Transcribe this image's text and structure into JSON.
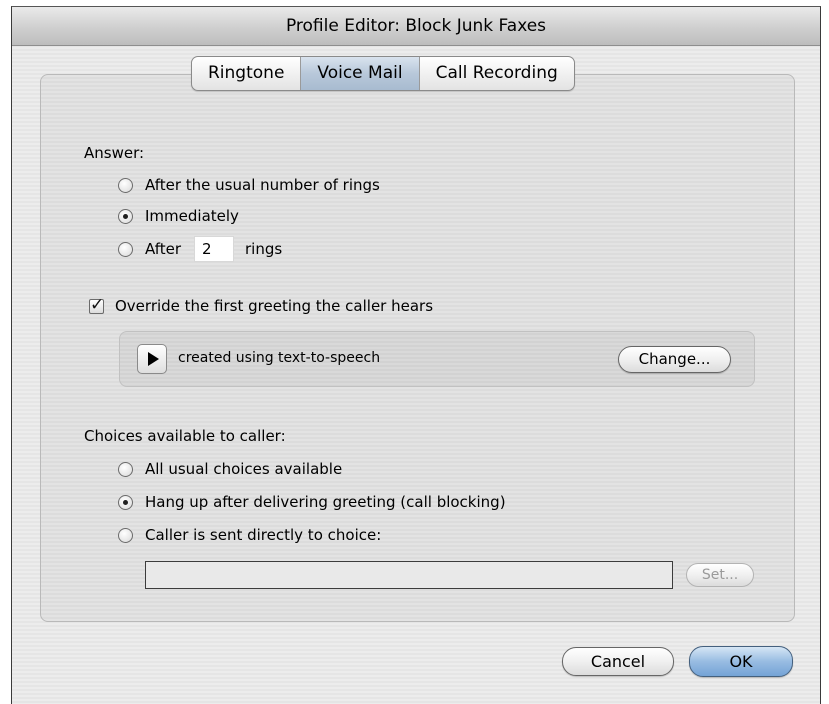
{
  "window": {
    "title": "Profile Editor: Block Junk Faxes"
  },
  "tabs": [
    {
      "label": "Ringtone",
      "selected": false
    },
    {
      "label": "Voice Mail",
      "selected": true
    },
    {
      "label": "Call Recording",
      "selected": false
    }
  ],
  "answer": {
    "heading": "Answer:",
    "options": [
      {
        "label": "After the usual number of rings",
        "selected": false
      },
      {
        "label": "Immediately",
        "selected": true
      },
      {
        "label": "After",
        "selected": false
      }
    ],
    "rings_value": "2",
    "rings_suffix": "rings"
  },
  "greeting": {
    "override_label": "Override the first greeting the caller hears",
    "override_checked": true,
    "description": "created using text-to-speech",
    "change_label": "Change..."
  },
  "choices": {
    "heading": "Choices available to caller:",
    "options": [
      {
        "label": "All usual choices available",
        "selected": false
      },
      {
        "label": "Hang up after delivering greeting (call blocking)",
        "selected": true
      },
      {
        "label": "Caller is sent directly to choice:",
        "selected": false
      }
    ],
    "choice_value": "",
    "set_label": "Set..."
  },
  "buttons": {
    "cancel": "Cancel",
    "ok": "OK"
  },
  "colors": {
    "default_button": "#74a3d6",
    "selected_tab": "#b8c8da"
  }
}
